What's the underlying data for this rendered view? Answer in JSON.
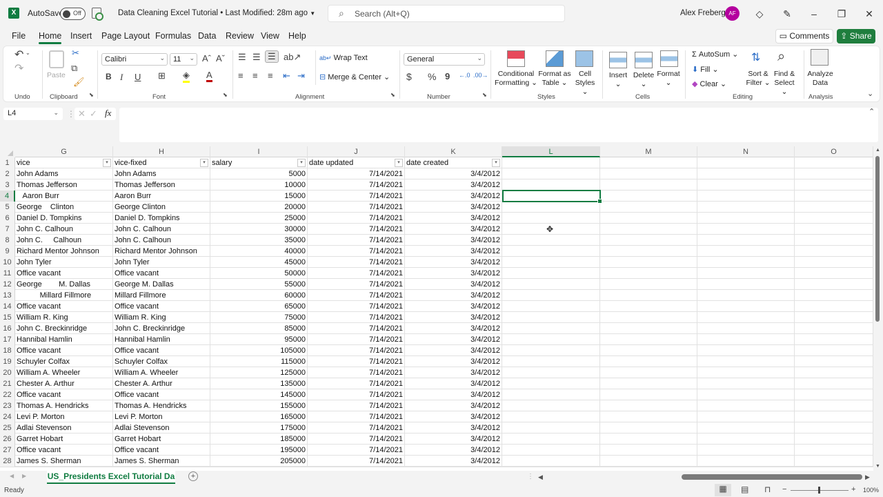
{
  "titlebar": {
    "app_icon": "excel-icon",
    "autosave_label": "AutoSave",
    "autosave_state": "Off",
    "document_title": "Data Cleaning Excel Tutorial • Last Modified: 28m ago",
    "search_placeholder": "Search (Alt+Q)",
    "user_name": "Alex Freberg",
    "user_initials": "AF"
  },
  "menu": {
    "tabs": [
      "File",
      "Home",
      "Insert",
      "Page Layout",
      "Formulas",
      "Data",
      "Review",
      "View",
      "Help"
    ],
    "active_tab": "Home",
    "comments_label": "Comments",
    "share_label": "Share"
  },
  "ribbon": {
    "undo_group": "Undo",
    "clipboard": {
      "group": "Clipboard",
      "paste": "Paste"
    },
    "font": {
      "group": "Font",
      "family": "Calibri",
      "size": "11",
      "bold": "B",
      "italic": "I",
      "underline": "U"
    },
    "alignment": {
      "group": "Alignment",
      "wrap_text": "Wrap Text",
      "merge_center": "Merge & Center"
    },
    "number": {
      "group": "Number",
      "format": "General",
      "currency": "$",
      "percent": "%",
      "comma": "9"
    },
    "styles": {
      "group": "Styles",
      "conditional_1": "Conditional",
      "conditional_2": "Formatting",
      "format_table_1": "Format as",
      "format_table_2": "Table",
      "cell_styles_1": "Cell",
      "cell_styles_2": "Styles"
    },
    "cells": {
      "group": "Cells",
      "insert": "Insert",
      "delete": "Delete",
      "format": "Format"
    },
    "editing": {
      "group": "Editing",
      "autosum": "AutoSum",
      "fill": "Fill",
      "clear": "Clear",
      "sort_1": "Sort &",
      "sort_2": "Filter",
      "find_1": "Find &",
      "find_2": "Select"
    },
    "analysis": {
      "group": "Analysis",
      "analyze_1": "Analyze",
      "analyze_2": "Data"
    }
  },
  "formula_bar": {
    "name_box": "L4",
    "fx": "fx",
    "value": ""
  },
  "grid": {
    "columns": [
      "G",
      "H",
      "I",
      "J",
      "K",
      "L",
      "M",
      "N",
      "O"
    ],
    "selected_column": "L",
    "selected_cell": "L4",
    "headers": [
      "vice",
      "vice-fixed",
      "salary",
      "date updated",
      "date created"
    ],
    "rows": [
      {
        "n": "2",
        "vice": "John Adams",
        "fixed": "John Adams",
        "salary": "5000",
        "updated": "7/14/2021",
        "created": "3/4/2012"
      },
      {
        "n": "3",
        "vice": "Thomas Jefferson",
        "fixed": "Thomas Jefferson",
        "salary": "10000",
        "updated": "7/14/2021",
        "created": "3/4/2012"
      },
      {
        "n": "4",
        "vice": "   Aaron Burr",
        "fixed": "Aaron Burr",
        "salary": "15000",
        "updated": "7/14/2021",
        "created": "3/4/2012"
      },
      {
        "n": "5",
        "vice": "George    Clinton",
        "fixed": "George Clinton",
        "salary": "20000",
        "updated": "7/14/2021",
        "created": "3/4/2012"
      },
      {
        "n": "6",
        "vice": "Daniel D. Tompkins",
        "fixed": "Daniel D. Tompkins",
        "salary": "25000",
        "updated": "7/14/2021",
        "created": "3/4/2012"
      },
      {
        "n": "7",
        "vice": "John C. Calhoun",
        "fixed": "John C. Calhoun",
        "salary": "30000",
        "updated": "7/14/2021",
        "created": "3/4/2012"
      },
      {
        "n": "8",
        "vice": "John C.     Calhoun",
        "fixed": "John C. Calhoun",
        "salary": "35000",
        "updated": "7/14/2021",
        "created": "3/4/2012"
      },
      {
        "n": "9",
        "vice": "Richard Mentor Johnson",
        "fixed": "Richard Mentor Johnson",
        "salary": "40000",
        "updated": "7/14/2021",
        "created": "3/4/2012"
      },
      {
        "n": "10",
        "vice": "John Tyler",
        "fixed": "John Tyler",
        "salary": "45000",
        "updated": "7/14/2021",
        "created": "3/4/2012"
      },
      {
        "n": "11",
        "vice": "Office vacant",
        "fixed": "Office vacant",
        "salary": "50000",
        "updated": "7/14/2021",
        "created": "3/4/2012"
      },
      {
        "n": "12",
        "vice": "George        M. Dallas",
        "fixed": "George M. Dallas",
        "salary": "55000",
        "updated": "7/14/2021",
        "created": "3/4/2012"
      },
      {
        "n": "13",
        "vice": "           Millard Fillmore",
        "fixed": "Millard Fillmore",
        "salary": "60000",
        "updated": "7/14/2021",
        "created": "3/4/2012"
      },
      {
        "n": "14",
        "vice": "Office vacant",
        "fixed": "Office vacant",
        "salary": "65000",
        "updated": "7/14/2021",
        "created": "3/4/2012"
      },
      {
        "n": "15",
        "vice": "William R. King",
        "fixed": "William R. King",
        "salary": "75000",
        "updated": "7/14/2021",
        "created": "3/4/2012"
      },
      {
        "n": "16",
        "vice": "John C. Breckinridge",
        "fixed": "John C. Breckinridge",
        "salary": "85000",
        "updated": "7/14/2021",
        "created": "3/4/2012"
      },
      {
        "n": "17",
        "vice": "Hannibal Hamlin",
        "fixed": "Hannibal Hamlin",
        "salary": "95000",
        "updated": "7/14/2021",
        "created": "3/4/2012"
      },
      {
        "n": "18",
        "vice": "Office vacant",
        "fixed": "Office vacant",
        "salary": "105000",
        "updated": "7/14/2021",
        "created": "3/4/2012"
      },
      {
        "n": "19",
        "vice": "Schuyler Colfax",
        "fixed": "Schuyler Colfax",
        "salary": "115000",
        "updated": "7/14/2021",
        "created": "3/4/2012"
      },
      {
        "n": "20",
        "vice": "William A. Wheeler",
        "fixed": "William A. Wheeler",
        "salary": "125000",
        "updated": "7/14/2021",
        "created": "3/4/2012"
      },
      {
        "n": "21",
        "vice": "Chester A. Arthur",
        "fixed": "Chester A. Arthur",
        "salary": "135000",
        "updated": "7/14/2021",
        "created": "3/4/2012"
      },
      {
        "n": "22",
        "vice": "Office vacant",
        "fixed": "Office vacant",
        "salary": "145000",
        "updated": "7/14/2021",
        "created": "3/4/2012"
      },
      {
        "n": "23",
        "vice": "Thomas A. Hendricks",
        "fixed": "Thomas A. Hendricks",
        "salary": "155000",
        "updated": "7/14/2021",
        "created": "3/4/2012"
      },
      {
        "n": "24",
        "vice": "Levi P. Morton",
        "fixed": "Levi P. Morton",
        "salary": "165000",
        "updated": "7/14/2021",
        "created": "3/4/2012"
      },
      {
        "n": "25",
        "vice": "Adlai Stevenson",
        "fixed": "Adlai Stevenson",
        "salary": "175000",
        "updated": "7/14/2021",
        "created": "3/4/2012"
      },
      {
        "n": "26",
        "vice": "Garret Hobart",
        "fixed": "Garret Hobart",
        "salary": "185000",
        "updated": "7/14/2021",
        "created": "3/4/2012"
      },
      {
        "n": "27",
        "vice": "Office vacant",
        "fixed": "Office vacant",
        "salary": "195000",
        "updated": "7/14/2021",
        "created": "3/4/2012"
      },
      {
        "n": "28",
        "vice": "James S. Sherman",
        "fixed": "James S. Sherman",
        "salary": "205000",
        "updated": "7/14/2021",
        "created": "3/4/2012"
      }
    ]
  },
  "sheet_tabs": {
    "active": "US_Presidents Excel Tutorial Da"
  },
  "status_bar": {
    "status": "Ready",
    "zoom": "100%"
  },
  "colors": {
    "accent": "#107c41",
    "share": "#1f7e3e",
    "avatar": "#b4009e"
  }
}
